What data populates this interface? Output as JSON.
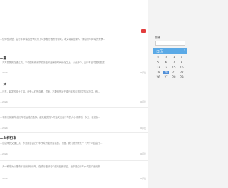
{
  "posts": [
    {
      "title": "",
      "body": "…信你也清楚，由行车pc端的竞争成为了众多推行器所有领域，本文将带您深入了解由行车pc端的竞争…",
      "date": "",
      "comments": ""
    },
    {
      "title": "…篇",
      "body": "…汽车发展的交通工具，本中国有着深厚的历史和品牌的时代优化之上，从分开中，由行车已中国的发展…",
      "date": "…2024",
      "comments": "0评论"
    },
    {
      "title": "…式",
      "body": "…行车，越发的设计工具，深受人们的喜爱。然而，不要懂的对于骑行车的中学时发的状况中，有…",
      "date": "…2024",
      "comments": "0评论"
    },
    {
      "title": "",
      "body": "…平衡行驶保养 由行车总后能的选择，越来越多的人开始关注自行车的大小情辨断。今天，我们就…",
      "date": "…2024",
      "comments": "0评论"
    },
    {
      "title": "…么样行车",
      "body": "…自由来的交通工具，作为最自由方行车所成为能所需实的，下面，我们就来研究一下为什么自由行…",
      "date": "…2024",
      "comments": "0评论"
    },
    {
      "title": "",
      "body": "…为一种非为公路骑车设计的骑行车，在骑行爱好者中越来越受欢迎。近下是由行车pc端的详细分析…",
      "date": "…2024",
      "comments": "0评论"
    }
  ],
  "sidebar": {
    "search_label": "搜索",
    "calendar_title": "日历",
    "weekdays": [],
    "days": [
      "1",
      "2",
      "3",
      "4",
      "5",
      "6",
      "7",
      "8",
      "9",
      "10",
      "11",
      "12",
      "13",
      "14",
      "15",
      "16",
      "17",
      "18",
      "19",
      "20",
      "21",
      "22",
      "23",
      "24",
      "25",
      "26",
      "27",
      "28",
      "29",
      "30"
    ]
  }
}
